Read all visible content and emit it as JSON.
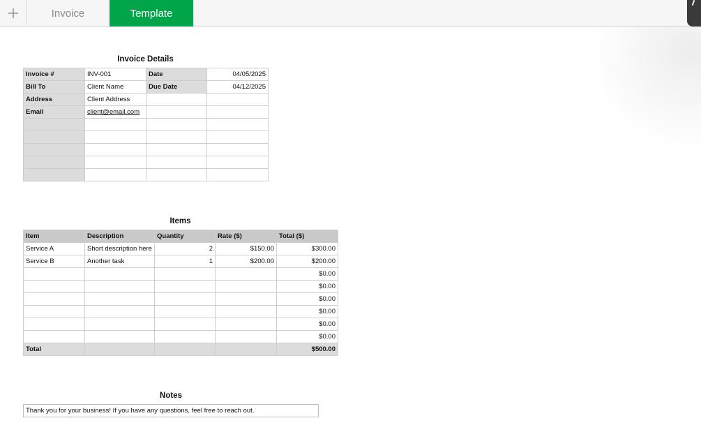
{
  "tabs": {
    "invoice": "Invoice",
    "template": "Template"
  },
  "colors": {
    "active_tab": "#00a54a"
  },
  "details": {
    "title": "Invoice Details",
    "rows": [
      [
        "Invoice #",
        "INV-001",
        "Date",
        "04/05/2025"
      ],
      [
        "Bill To",
        "Client Name",
        "Due Date",
        "04/12/2025"
      ],
      [
        "Address",
        "Client Address",
        "",
        ""
      ],
      [
        "Email",
        "client@email.com",
        "",
        ""
      ],
      [
        "",
        "",
        "",
        ""
      ],
      [
        "",
        "",
        "",
        ""
      ],
      [
        "",
        "",
        "",
        ""
      ],
      [
        "",
        "",
        "",
        ""
      ],
      [
        "",
        "",
        "",
        ""
      ]
    ]
  },
  "items": {
    "title": "Items",
    "headers": [
      "Item",
      "Description",
      "Quantity",
      "Rate ($)",
      "Total ($)"
    ],
    "rows": [
      [
        "Service A",
        "Short description here",
        "2",
        "$150.00",
        "$300.00"
      ],
      [
        "Service B",
        "Another task",
        "1",
        "$200.00",
        "$200.00"
      ],
      [
        "",
        "",
        "",
        "",
        "$0.00"
      ],
      [
        "",
        "",
        "",
        "",
        "$0.00"
      ],
      [
        "",
        "",
        "",
        "",
        "$0.00"
      ],
      [
        "",
        "",
        "",
        "",
        "$0.00"
      ],
      [
        "",
        "",
        "",
        "",
        "$0.00"
      ],
      [
        "",
        "",
        "",
        "",
        "$0.00"
      ]
    ],
    "total_label": "Total",
    "total_value": "$500.00"
  },
  "notes": {
    "title": "Notes",
    "text": "Thank you for your business! If you have any questions, feel free to reach out."
  }
}
